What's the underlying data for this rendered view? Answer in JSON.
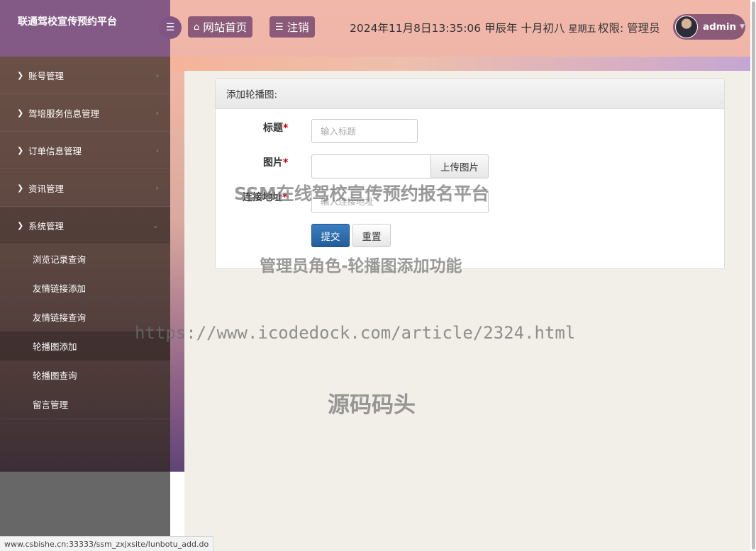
{
  "brand": "联通驾校宣传预约平台",
  "sidebar": {
    "items": [
      {
        "label": "账号管理"
      },
      {
        "label": "驾培服务信息管理"
      },
      {
        "label": "订单信息管理"
      },
      {
        "label": "资讯管理"
      },
      {
        "label": "系统管理"
      }
    ],
    "submenu": [
      {
        "label": "浏览记录查询"
      },
      {
        "label": "友情链接添加"
      },
      {
        "label": "友情链接查询"
      },
      {
        "label": "轮播图添加"
      },
      {
        "label": "轮播图查询"
      },
      {
        "label": "留言管理"
      }
    ]
  },
  "header": {
    "home_label": "网站首页",
    "logout_label": "注销",
    "datetime": "2024年11月8日13:35:06 甲辰年 十月初八",
    "weekday": "星期五",
    "permission": "权限: 管理员",
    "username": "admin"
  },
  "form": {
    "panel_title": "添加轮播图:",
    "title_label": "标题",
    "title_placeholder": "输入标题",
    "image_label": "图片",
    "image_value": "",
    "upload_label": "上传图片",
    "link_label": "连接地址",
    "link_placeholder": "输入连接地址",
    "required_mark": "*",
    "submit_label": "提交",
    "reset_label": "重置"
  },
  "watermarks": {
    "w1": "SSM在线驾校宣传预约报名平台",
    "w2": "管理员角色-轮播图添加功能",
    "w3": "https://www.icodedock.com/article/2324.html",
    "w4": "源码码头"
  },
  "status_url": "www.csbishe.cn:33333/ssm_zxjxsite/lunbotu_add.do"
}
